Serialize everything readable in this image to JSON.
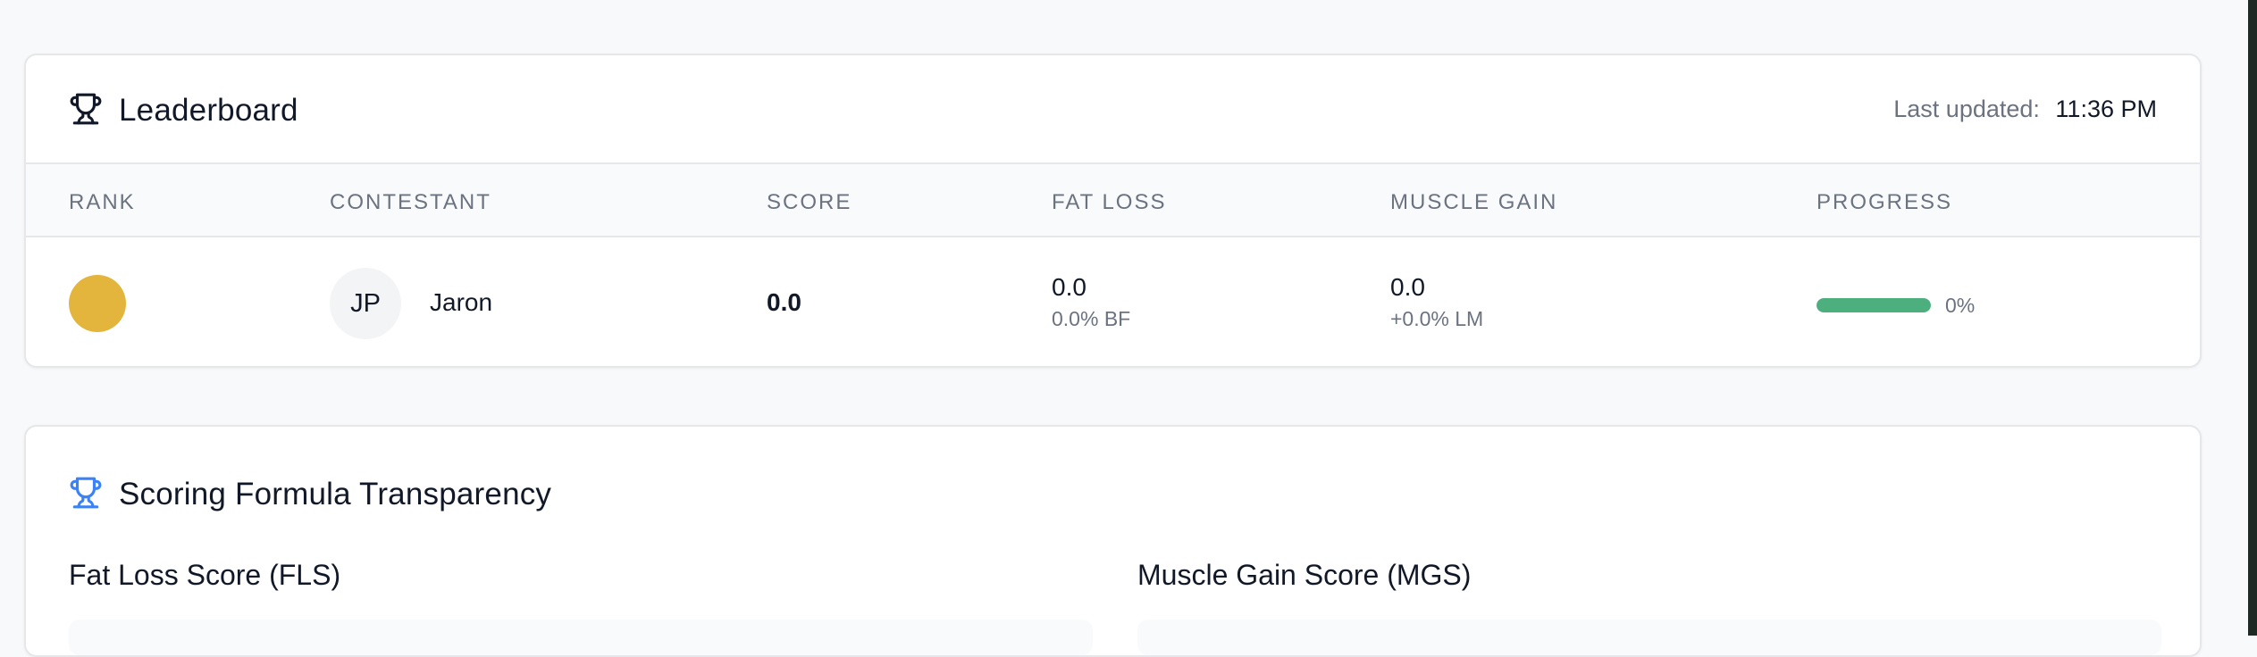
{
  "leaderboard": {
    "title": "Leaderboard",
    "last_updated_label": "Last updated:",
    "last_updated_time": "11:36 PM",
    "columns": [
      "RANK",
      "CONTESTANT",
      "SCORE",
      "FAT LOSS",
      "MUSCLE GAIN",
      "PROGRESS"
    ],
    "rows": [
      {
        "rank_medal_color": "#e3b53d",
        "initials": "JP",
        "name": "Jaron",
        "score": "0.0",
        "fat_loss": "0.0",
        "fat_loss_sub": "0.0% BF",
        "muscle_gain": "0.0",
        "muscle_gain_sub": "+0.0% LM",
        "progress_percent": 0,
        "progress_text": "0%",
        "progress_color": "#4caf7d"
      }
    ]
  },
  "scoring": {
    "title": "Scoring Formula Transparency",
    "fat_loss_title": "Fat Loss Score (FLS)",
    "muscle_gain_title": "Muscle Gain Score (MGS)",
    "icon_color": "#3b82f6"
  },
  "icons": {
    "leaderboard_icon": "trophy-icon",
    "scoring_icon": "trophy-icon"
  }
}
